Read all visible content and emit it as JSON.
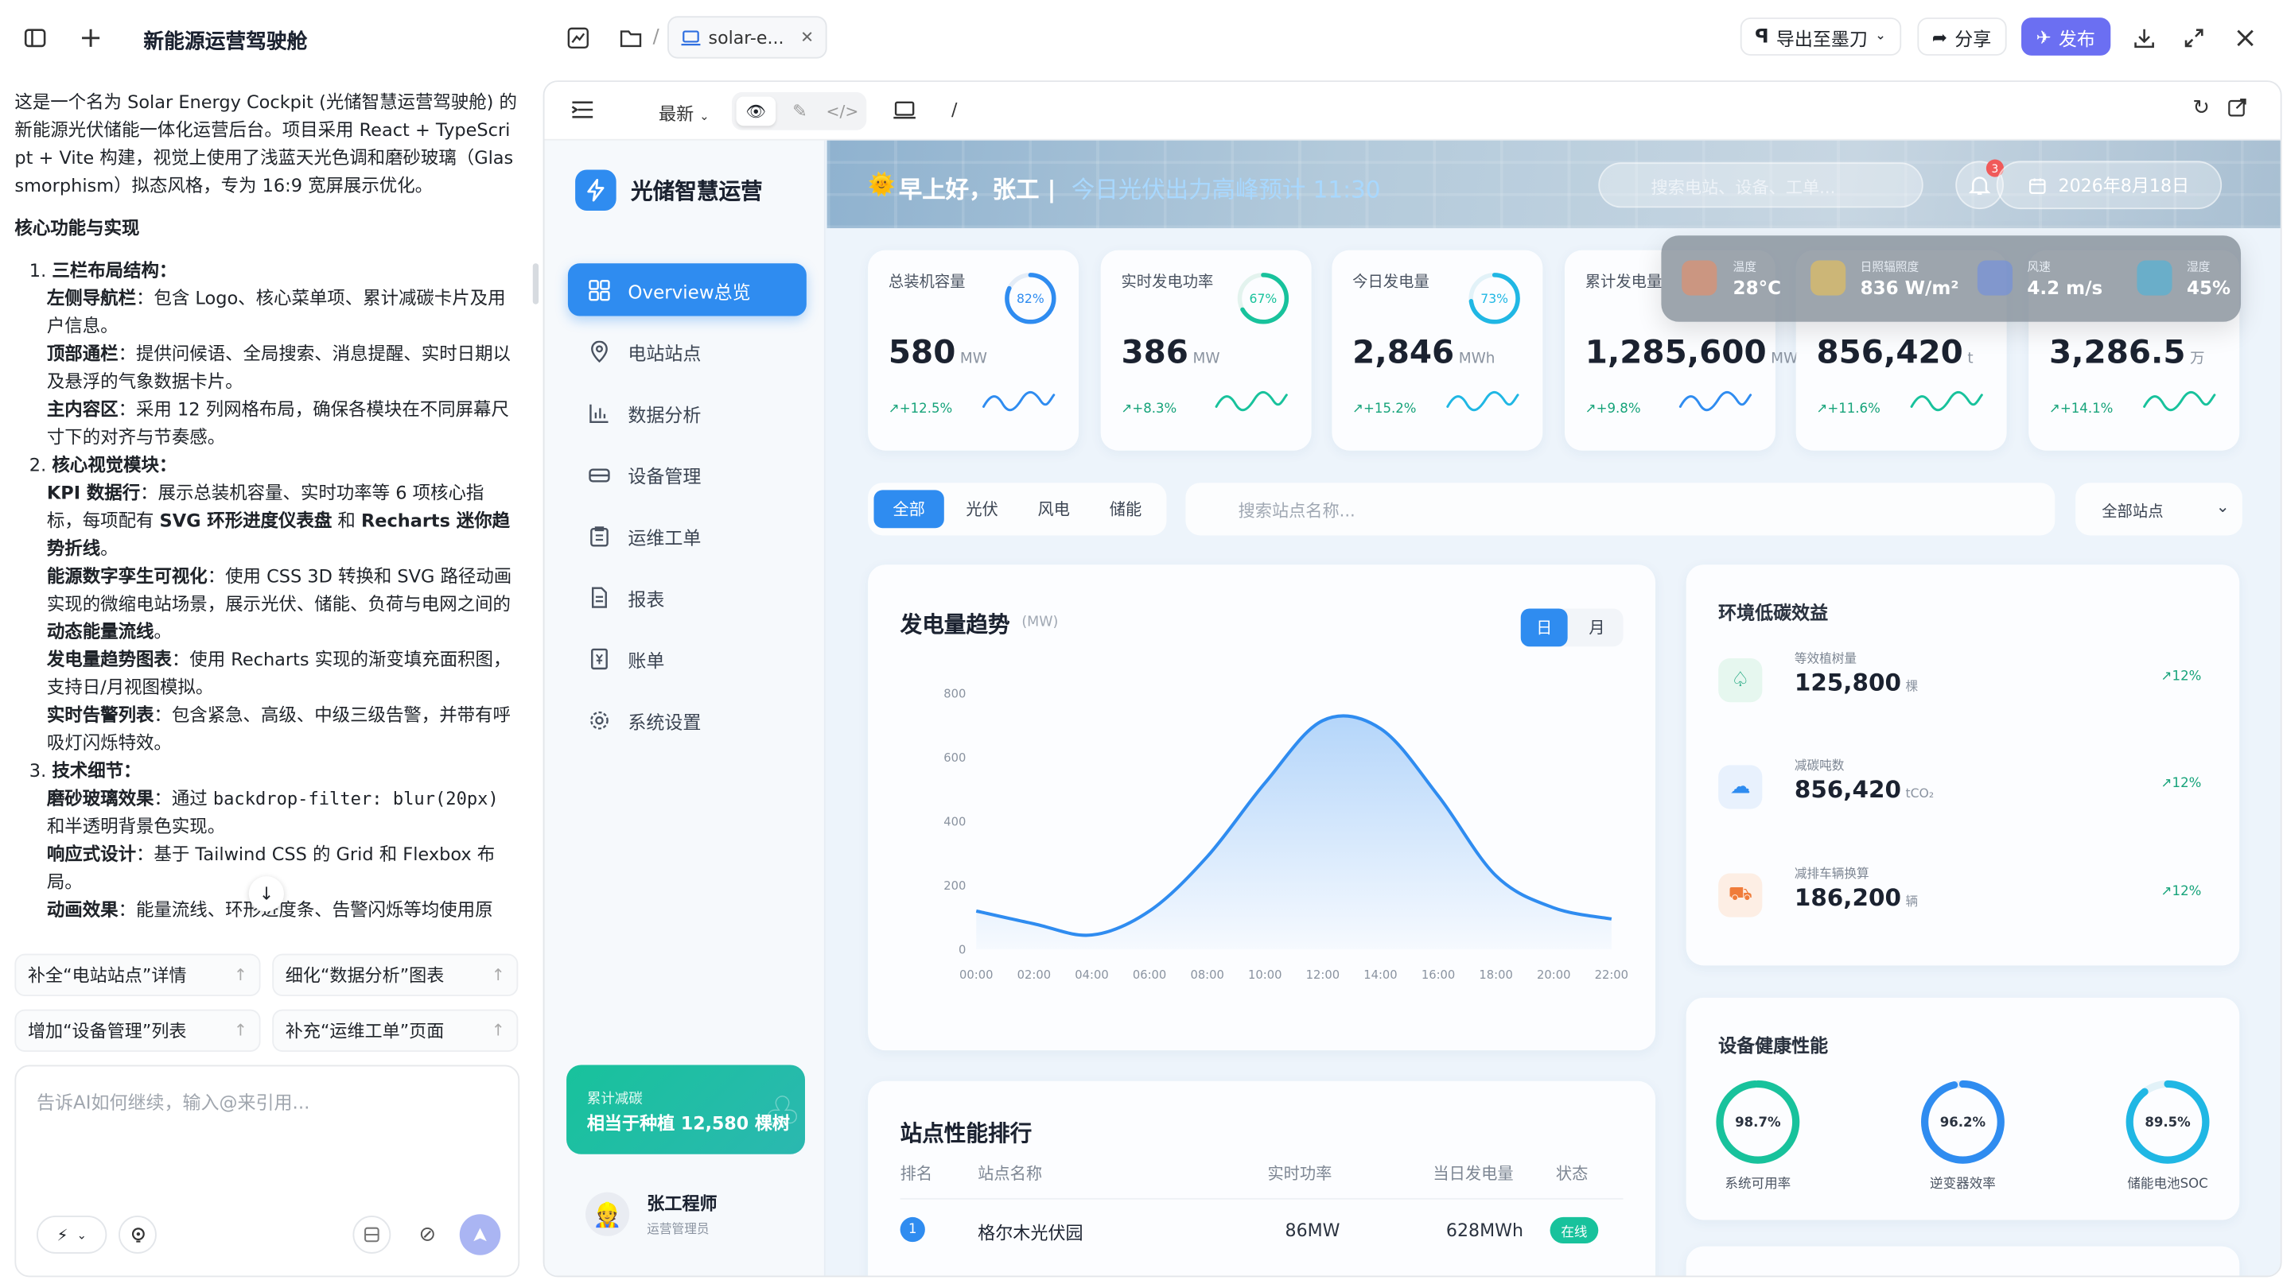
{
  "window": {
    "title": "新能源运营驾驶舱",
    "tab_label": "solar-e...",
    "path_sep": "/"
  },
  "toolbar": {
    "export_label": "导出至墨刀",
    "share_label": "分享",
    "publish_label": "发布",
    "version_label": "最新",
    "url_path": "/"
  },
  "chat": {
    "intro": "这是一个名为 Solar Energy Cockpit (光储智慧运营驾驶舱) 的新能源光伏储能一体化运营后台。项目采用 React + TypeScript + Vite 构建，视觉上使用了浅蓝天光色调和磨砂玻璃（Glassmorphism）拟态风格，专为 16:9 宽屏展示优化。",
    "heading": "核心功能与实现",
    "s1_title": "三栏布局结构：",
    "s1_a_b": "左侧导航栏",
    "s1_a": "：包含 Logo、核心菜单项、累计减碳卡片及用户信息。",
    "s1_b_b": "顶部通栏",
    "s1_b": "：提供问候语、全局搜索、消息提醒、实时日期以及悬浮的气象数据卡片。",
    "s1_c_b": "主内容区",
    "s1_c": "：采用 12 列网格布局，确保各模块在不同屏幕尺寸下的对齐与节奏感。",
    "s2_title": "核心视觉模块：",
    "s2_a_b": "KPI 数据行",
    "s2_a": "：展示总装机容量、实时功率等 6 项核心指标，每项配有 ",
    "s2_a_b2": "SVG 环形进度仪表盘",
    "s2_a_mid": " 和 ",
    "s2_a_b3": "Recharts 迷你趋势折线",
    "s2_a_end": "。",
    "s2_b_b": "能源数字孪生可视化",
    "s2_b": "：使用 CSS 3D 转换和 SVG 路径动画实现的微缩电站场景，展示光伏、储能、负荷与电网之间的",
    "s2_b_b2": "动态能量流线",
    "s2_b_end": "。",
    "s2_c_b": "发电量趋势图表",
    "s2_c": "：使用 Recharts 实现的渐变填充面积图，支持日/月视图模拟。",
    "s2_d_b": "实时告警列表",
    "s2_d": "：包含紧急、高级、中级三级告警，并带有呼吸灯闪烁特效。",
    "s3_title": "技术细节：",
    "s3_a_b": "磨砂玻璃效果",
    "s3_a_pre": "：通过 ",
    "s3_a_code": "backdrop-filter: blur(20px)",
    "s3_a": " 和半透明背景色实现。",
    "s3_b_b": "响应式设计",
    "s3_b": "：基于 Tailwind CSS 的 Grid 和 Flexbox 布局。",
    "s3_c_b": "动画效果",
    "s3_c": "：能量流线、环形进度条、告警闪烁等均使用原",
    "suggestions": [
      "补全“电站站点”详情",
      "细化“数据分析”图表",
      "增加“设备管理”列表",
      "补充“运维工单”页面"
    ],
    "input_placeholder": "告诉AI如何继续，输入@来引用..."
  },
  "app": {
    "brand": "光储智慧运营",
    "nav": [
      "Overview总览",
      "电站站点",
      "数据分析",
      "设备管理",
      "运维工单",
      "报表",
      "账单",
      "系统设置"
    ],
    "carbon_card": {
      "label": "累计减碳",
      "value": "相当于种植 12,580 棵树"
    },
    "user": {
      "name": "张工程师",
      "role": "运营管理员"
    },
    "greeting": "早上好，张工 |",
    "greeting_highlight": "今日光伏出力高峰预计 11:30",
    "search_placeholder": "搜索电站、设备、工单...",
    "notif_count": "3",
    "date": "2026年8月18日",
    "weather": [
      {
        "label": "温度",
        "value": "28°C",
        "color": "#f08a5d"
      },
      {
        "label": "日照辐照度",
        "value": "836 W/m²",
        "color": "#f3c54a"
      },
      {
        "label": "风速",
        "value": "4.2 m/s",
        "color": "#6a8de8"
      },
      {
        "label": "湿度",
        "value": "45%",
        "color": "#3fb6e0"
      }
    ],
    "kpis": [
      {
        "label": "总装机容量",
        "value": "580",
        "unit": "MW",
        "change": "+12.5%",
        "ring": "82%",
        "pct": 0.82,
        "color": "#2f8cf0"
      },
      {
        "label": "实时发电功率",
        "value": "386",
        "unit": "MW",
        "change": "+8.3%",
        "ring": "67%",
        "pct": 0.67,
        "color": "#18c29c"
      },
      {
        "label": "今日发电量",
        "value": "2,846",
        "unit": "MWh",
        "change": "+15.2%",
        "ring": "73%",
        "pct": 0.73,
        "color": "#20b7e4"
      },
      {
        "label": "累计发电量",
        "value": "1,285,600",
        "unit": "MW",
        "change": "+9.8%",
        "ring": "",
        "pct": 0,
        "color": "#2f8cf0"
      },
      {
        "label": "",
        "value": "856,420",
        "unit": "t",
        "change": "+11.6%",
        "ring": "",
        "pct": 0,
        "color": "#18c29c"
      },
      {
        "label": "",
        "value": "3,286.5",
        "unit": "万",
        "change": "+14.1%",
        "ring": "",
        "pct": 0,
        "color": "#18c29c"
      }
    ],
    "filter_tabs": [
      "全部",
      "光伏",
      "风电",
      "储能"
    ],
    "station_search_placeholder": "搜索站点名称...",
    "station_select": "全部站点",
    "chart_title": "发电量趋势",
    "chart_unit": "(MW)",
    "chart_toggle": [
      "日",
      "月"
    ],
    "env": {
      "title": "环境低碳效益",
      "items": [
        {
          "label": "等效植树量",
          "value": "125,800",
          "unit": "棵",
          "change": "12%",
          "color": "#16a37a",
          "bg": "#e6f7ef"
        },
        {
          "label": "减碳吨数",
          "value": "856,420",
          "unit": "tCO₂",
          "change": "12%",
          "color": "#2f8cf0",
          "bg": "#e8f1fd"
        },
        {
          "label": "减排车辆换算",
          "value": "186,200",
          "unit": "辆",
          "change": "12%",
          "color": "#f07c3a",
          "bg": "#fdeee4"
        }
      ]
    },
    "health": {
      "title": "设备健康性能",
      "items": [
        {
          "label": "系统可用率",
          "value": "98.7%",
          "pct": 0.987,
          "color": "#18c29c"
        },
        {
          "label": "逆变器效率",
          "value": "96.2%",
          "pct": 0.962,
          "color": "#2f8cf0"
        },
        {
          "label": "储能电池SOC",
          "value": "89.5%",
          "pct": 0.895,
          "color": "#20b7e4"
        }
      ]
    },
    "ranking": {
      "title": "站点性能排行",
      "headers": [
        "排名",
        "站点名称",
        "实时功率",
        "当日发电量",
        "状态"
      ],
      "rows": [
        {
          "rank": "1",
          "name": "格尔木光伏园",
          "power": "86MW",
          "energy": "628MWh",
          "status": "在线"
        }
      ]
    }
  },
  "chart_data": {
    "type": "area",
    "title": "发电量趋势",
    "ylabel": "(MW)",
    "x": [
      "00:00",
      "02:00",
      "04:00",
      "06:00",
      "08:00",
      "10:00",
      "12:00",
      "14:00",
      "16:00",
      "18:00",
      "20:00",
      "22:00"
    ],
    "series": [
      {
        "values": [
          120,
          80,
          45,
          120,
          290,
          520,
          715,
          690,
          480,
          230,
          130,
          95
        ]
      }
    ],
    "ylim": [
      0,
      800
    ],
    "yticks": [
      "0",
      "200",
      "400",
      "600",
      "800"
    ],
    "grid": false,
    "color": "#2f8cf0"
  }
}
